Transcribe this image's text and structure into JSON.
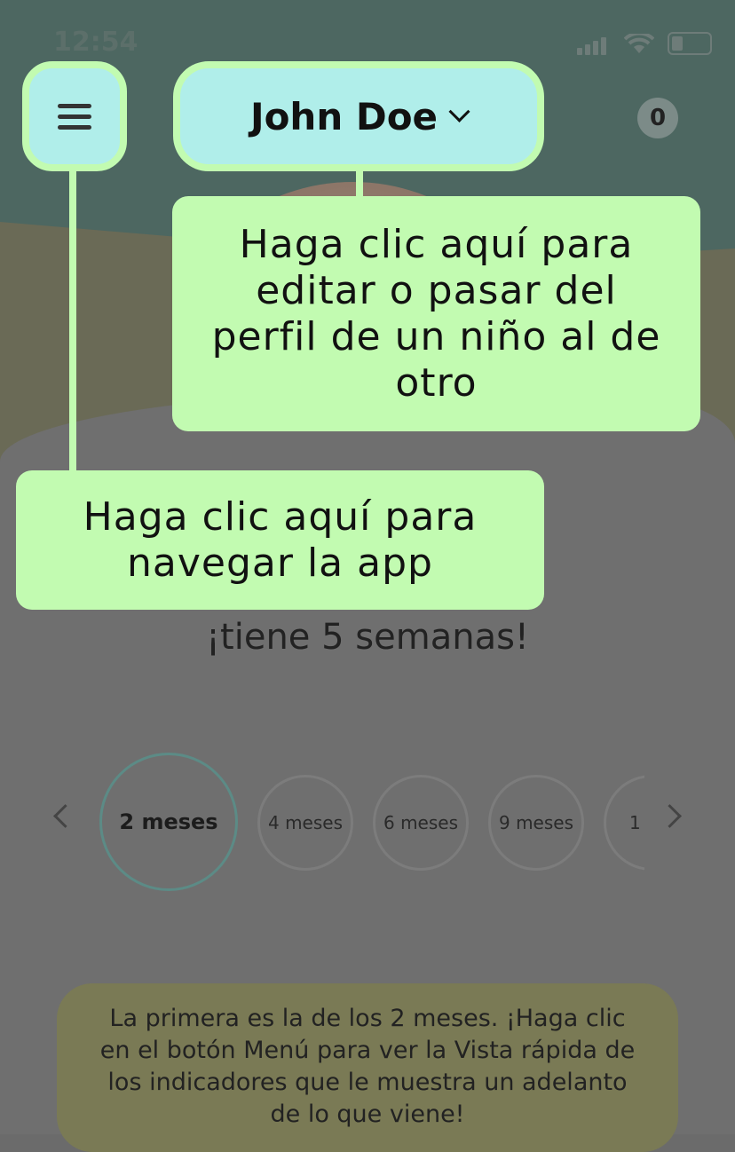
{
  "status_bar": {
    "time": "12:54"
  },
  "header": {
    "profile_name": "John Doe",
    "notification_count": "0"
  },
  "tooltips": {
    "profile_tip": "Haga clic aquí para editar o pasar del perfil de un niño al de otro",
    "menu_tip": "Haga clic aquí para navegar la app"
  },
  "child": {
    "age_text": "¡tiene 5 semanas!"
  },
  "milestones": {
    "items": [
      "2 meses",
      "4 meses",
      "6 meses",
      "9 meses",
      "1 ."
    ],
    "selected": "2 meses"
  },
  "info": {
    "text": "La primera es la de los 2 meses. ¡Haga clic en el botón Menú para ver la Vista rápida de los indicadores que le muestra un adelanto de lo que viene!"
  },
  "colors": {
    "highlight": "#c2fbb1",
    "button_fill": "#b0eeea",
    "overlay_teal": "#4d6761"
  },
  "icons": [
    "menu-icon",
    "chevron-down-icon",
    "chevron-left-icon",
    "chevron-right-icon",
    "signal-icon",
    "wifi-icon",
    "battery-icon"
  ]
}
